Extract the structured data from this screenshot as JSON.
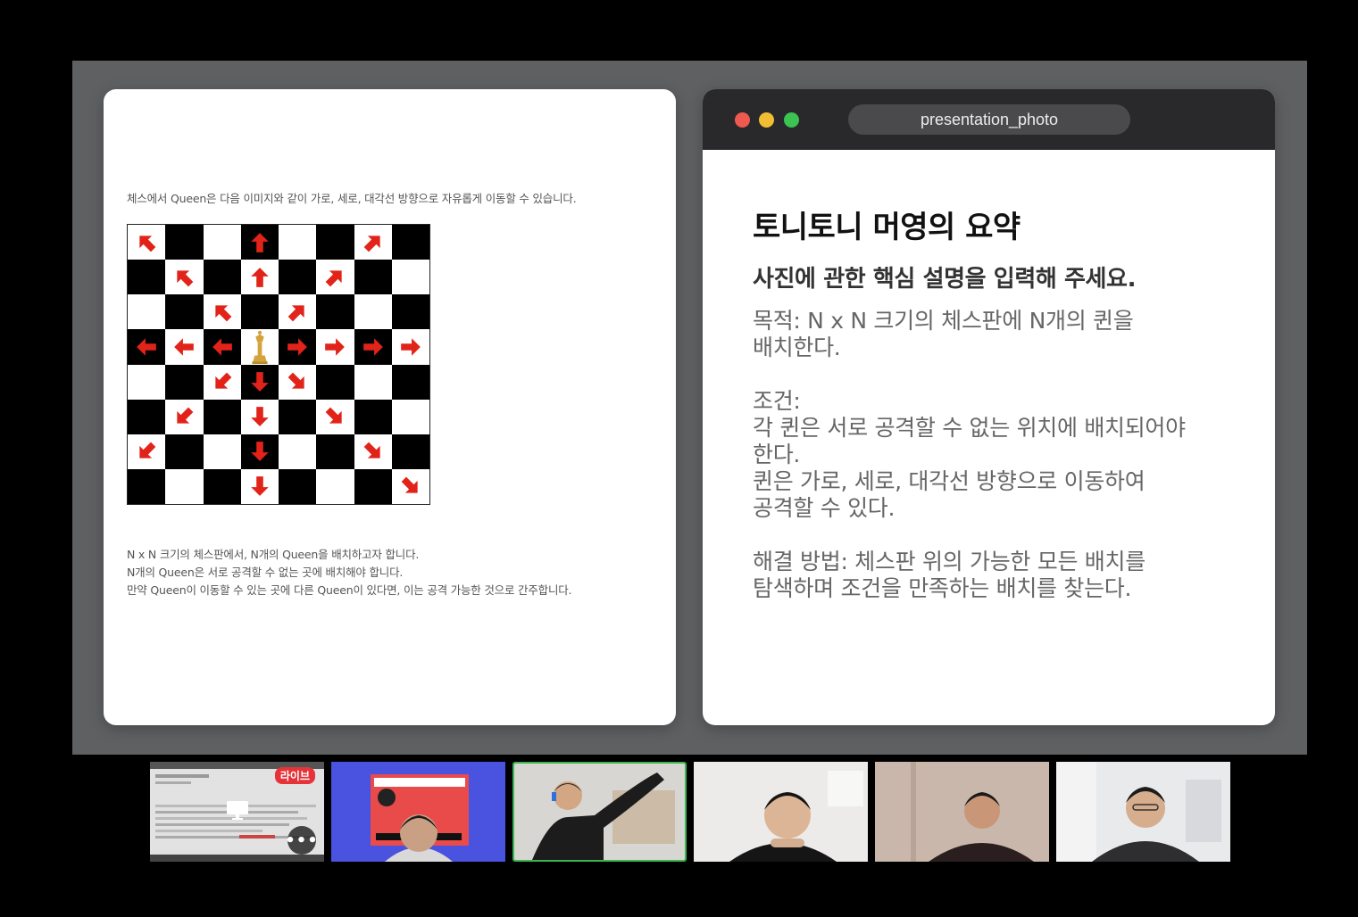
{
  "left_slide": {
    "intro": "체스에서 Queen은 다음 이미지와 같이 가로, 세로, 대각선 방향으로 자유롭게 이동할 수 있습니다.",
    "notes": [
      "N x N 크기의 체스판에서, N개의 Queen을 배치하고자 합니다.",
      "N개의 Queen은 서로 공격할 수 없는 곳에 배치해야 합니다.",
      "만약 Queen이 이동할 수 있는 곳에 다른 Queen이 있다면, 이는 공격 가능한 것으로 간주합니다."
    ],
    "board": {
      "size": 8,
      "queen": [
        3,
        3
      ],
      "arrows": [
        [
          0,
          0,
          "nw"
        ],
        [
          0,
          3,
          "n"
        ],
        [
          0,
          6,
          "ne"
        ],
        [
          1,
          1,
          "nw"
        ],
        [
          1,
          3,
          "n"
        ],
        [
          1,
          5,
          "ne"
        ],
        [
          2,
          2,
          "nw"
        ],
        [
          2,
          4,
          "ne"
        ],
        [
          3,
          0,
          "w"
        ],
        [
          3,
          1,
          "w"
        ],
        [
          3,
          2,
          "w"
        ],
        [
          3,
          4,
          "e"
        ],
        [
          3,
          5,
          "e"
        ],
        [
          3,
          6,
          "e"
        ],
        [
          3,
          7,
          "e"
        ],
        [
          4,
          2,
          "sw"
        ],
        [
          4,
          3,
          "s"
        ],
        [
          4,
          4,
          "se"
        ],
        [
          5,
          1,
          "sw"
        ],
        [
          5,
          3,
          "s"
        ],
        [
          5,
          5,
          "se"
        ],
        [
          6,
          0,
          "sw"
        ],
        [
          6,
          3,
          "s"
        ],
        [
          6,
          6,
          "se"
        ],
        [
          7,
          3,
          "s"
        ],
        [
          7,
          7,
          "se"
        ]
      ],
      "arrow_color": "#e2231a",
      "queen_color": "#d4a33a"
    }
  },
  "right_slide": {
    "window_title": "presentation_photo",
    "title": "토니토니 머영의 요약",
    "subtitle": "사진에 관한 핵심 설명을 입력해 주세요.",
    "body_lines": [
      "목적: N x N 크기의 체스판에 N개의 퀸을",
      "배치한다.",
      "",
      "조건:",
      "각 퀸은 서로 공격할 수 없는 위치에 배치되어야",
      "한다.",
      "퀸은 가로, 세로, 대각선 방향으로 이동하여",
      "공격할 수 있다.",
      "",
      "해결 방법: 체스판 위의 가능한 모든 배치를",
      "탐색하며 조건을 만족하는 배치를 찾는다."
    ]
  },
  "participants": {
    "live_badge": "라이브",
    "more_label": "•••",
    "tiles": [
      {
        "kind": "screen-share",
        "bg": "#e4e4e4"
      },
      {
        "kind": "camera",
        "bg": "#4a52e0",
        "shirt": "#d9d9d9",
        "hair": "#1b1b1b"
      },
      {
        "kind": "camera",
        "bg": "#d8d6d2",
        "shirt": "#1c1c1c",
        "hair": "#2a2a2a",
        "active": true
      },
      {
        "kind": "camera",
        "bg": "#ecebea",
        "shirt": "#151515",
        "hair": "#151515"
      },
      {
        "kind": "camera",
        "bg": "#c9b7ac",
        "shirt": "#2b1e1e",
        "hair": "#1a1a1a"
      },
      {
        "kind": "camera",
        "bg": "#e9eaec",
        "shirt": "#2e2e30",
        "hair": "#1c1c1c"
      }
    ]
  }
}
